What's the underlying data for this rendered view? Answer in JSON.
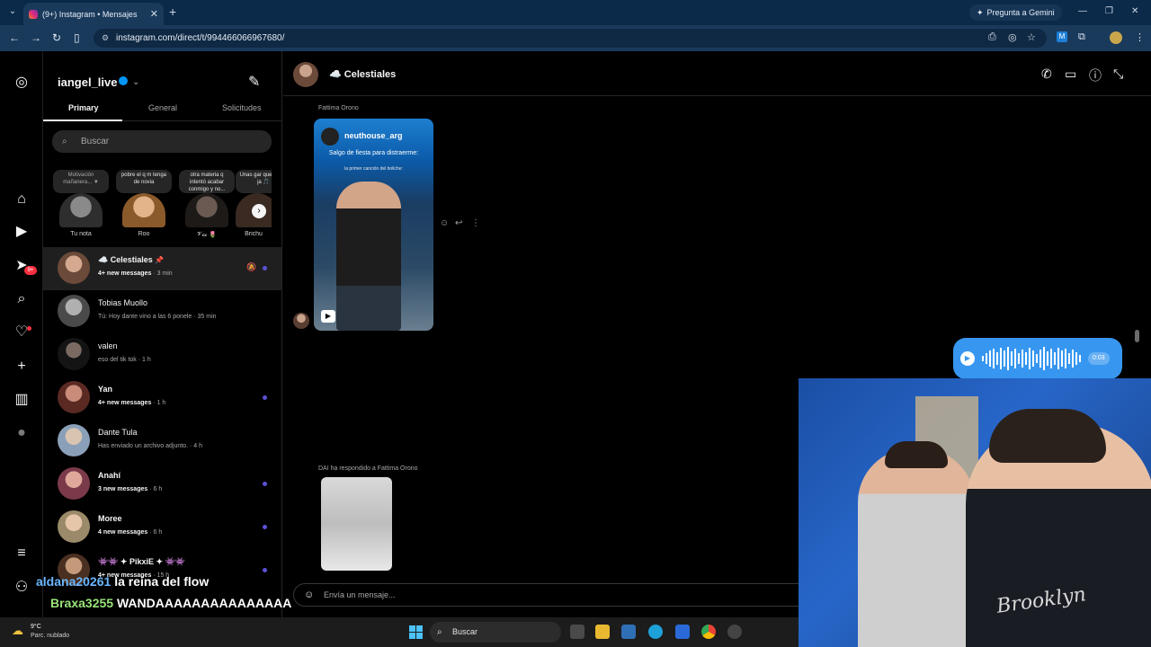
{
  "browser": {
    "tab_title": "(9+) Instagram • Mensajes",
    "gemini_label": "Pregunta a Gemini",
    "url": "instagram.com/direct/t/994466066967680/"
  },
  "inbox": {
    "username": "iangel_live",
    "tabs": [
      "Primary",
      "General",
      "Solicitudes"
    ],
    "search_placeholder": "Buscar",
    "notes": [
      {
        "text": "Motivación mañanera... ▼",
        "name": "Tu nota"
      },
      {
        "text": "pobre el q m tenga de novia",
        "name": "Roo"
      },
      {
        "text": "otra materia q intentó acabar conmigo y no...",
        "name": "𝓥𝓲𝓬 🌷"
      },
      {
        "text": "Unas gar que ¿e qu ja 🎵",
        "name": "Brichu"
      }
    ],
    "conversations": [
      {
        "name": "☁️ Celestiales",
        "preview": "4+ new messages",
        "time": "· 3 min",
        "bold": true,
        "unread": true
      },
      {
        "name": "Tobias Muollo",
        "preview": "Tú: Hoy dante vino a las 6 ponele",
        "time": "· 35 min",
        "bold": false,
        "unread": false
      },
      {
        "name": "valen",
        "preview": "eso del tik tok",
        "time": "· 1 h",
        "bold": false,
        "unread": false
      },
      {
        "name": "Yan",
        "preview": "4+ new messages",
        "time": "· 1 h",
        "bold": true,
        "unread": true
      },
      {
        "name": "Dante Tula",
        "preview": "Has enviado un archivo adjunto.",
        "time": "· 4 h",
        "bold": false,
        "unread": false
      },
      {
        "name": "Anahí",
        "preview": "3 new messages",
        "time": "· 6 h",
        "bold": true,
        "unread": true
      },
      {
        "name": "Moree",
        "preview": "4 new messages",
        "time": "· 6 h",
        "bold": true,
        "unread": true
      },
      {
        "name": "👾👾 ✦ PikxiE ✦ 👾👾",
        "preview": "4+ new messages",
        "time": "· 15 h",
        "bold": true,
        "unread": true
      }
    ]
  },
  "chat": {
    "title": "☁️ Celestiales",
    "sender1": "Fattima Orono",
    "reel_handle": "neuthouse_arg",
    "reel_caption": "Salgo de fiesta para distraerme:",
    "reel_sub": "la primer canción del boliche:",
    "audio_time": "0:03",
    "reply_label": "DAI ha respondido a Fattima Orono",
    "input_placeholder": "Envía un mensaje..."
  },
  "stream_chat": [
    {
      "user": "aldana20261",
      "message": "la reina del flow"
    },
    {
      "user": "Braxa3255",
      "message": "WANDAAAAAAAAAAAAAAA"
    }
  ],
  "webcam": {
    "shirt_text": "Brooklyn"
  },
  "taskbar": {
    "temperature": "9°C",
    "weather": "Parc. nublado",
    "search_label": "Buscar"
  },
  "icons": {
    "rail": [
      "instagram-icon",
      "home-icon",
      "reels-icon",
      "messages-icon",
      "search-icon",
      "heart-icon",
      "create-icon",
      "dashboard-icon",
      "profile-icon",
      "menu-icon",
      "threads-icon"
    ],
    "rail_badge": "9+"
  },
  "colors": {
    "accent": "#0095f6",
    "unread": "#5b51d8",
    "audio_bubble": "#3797f0",
    "chrome": "#1a3a5c"
  }
}
